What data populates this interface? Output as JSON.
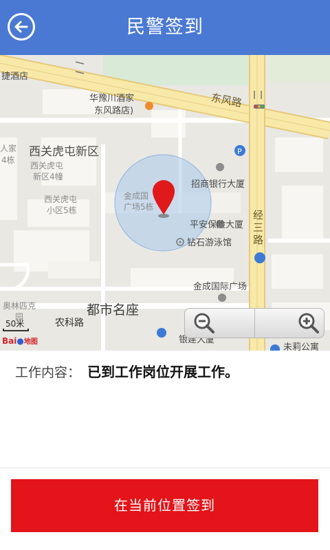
{
  "header": {
    "title": "民警签到",
    "back_icon": "back-arrow-icon"
  },
  "map": {
    "roads": {
      "dongfeng": "东风路",
      "jingsan": "经三路",
      "nongke": "农科路"
    },
    "districts": {
      "xiguan": "西关虎屯新区",
      "dushi": "都市名座"
    },
    "pois": {
      "jiudian": "捷酒店",
      "huayu": "华豫川酒家",
      "huayu_sub": "东风路店)",
      "zhaoshang": "招商银行大厦",
      "pingan": "平安保险大厦",
      "zuanshi": "钻石游泳馆",
      "jincheng_intl": "金成国际广场",
      "jincheng_a": "金成国",
      "jincheng_b": "广场5栋",
      "xiguan_a": "西关虎屯",
      "xiguan_b": "新区4幢",
      "xiguan_c": "西关虎屯",
      "xiguan_d": "小区5栋",
      "renjia_a": "人家",
      "renjia_b": "4栋",
      "aolin_a": "奥林匹克",
      "aolin_b": "园",
      "yinhang": "银建大厦",
      "right_bottom": "未莉公寓"
    },
    "scale": "50米",
    "logo": "Bai",
    "logo_suffix": "地图",
    "zoom_out_icon": "zoom-out-icon",
    "zoom_in_icon": "zoom-in-icon",
    "colors": {
      "location_circle": "#a9c8ec",
      "pin": "#e0191a",
      "major_road": "#f7e7a0"
    }
  },
  "content": {
    "label": "工作内容：",
    "value": "已到工作岗位开展工作。"
  },
  "action": {
    "checkin_label": "在当前位置签到",
    "color": "#e3141a"
  }
}
